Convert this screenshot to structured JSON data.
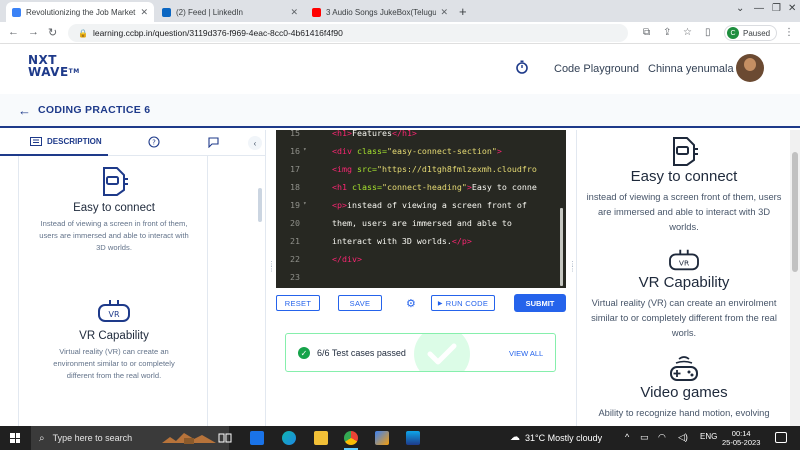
{
  "browser": {
    "tabs": [
      {
        "title": "Revolutionizing the Job Market |",
        "favicon_color": "#3b82f6",
        "active": true
      },
      {
        "title": "(2) Feed | LinkedIn",
        "favicon_color": "#0a66c2",
        "active": false
      },
      {
        "title": "3 Audio Songs JukeBox(Telugu) |",
        "favicon_color": "#ff0000",
        "active": false
      }
    ],
    "url": "learning.ccbp.in/question/3119d376-f969-4eac-8cc0-4b61416f4f90",
    "profile_initial": "C",
    "profile_status": "Paused"
  },
  "site": {
    "logo_line1": "NXT",
    "logo_line2": "WAVE",
    "logo_sub": "TM",
    "nav_playground": "Code Playground",
    "user_name": "Chinna yenumala",
    "brand_color": "#1e3a8a"
  },
  "practice": {
    "title": "CODING PRACTICE 6"
  },
  "left_panel": {
    "tab_description": "DESCRIPTION",
    "features": [
      {
        "icon": "vr-headset-icon",
        "heading": "Easy to connect",
        "text": "Instead of viewing a screen in front of them, users are immersed and able to interact with 3D worlds."
      },
      {
        "icon": "vr-goggles-icon",
        "heading": "VR Capability",
        "text": "Virtual reality (VR) can create an environment similar to or completely different from the real world."
      }
    ]
  },
  "editor": {
    "lines": [
      {
        "num": "15",
        "fold": false,
        "parts": [
          {
            "t": "tag",
            "v": "<h1>"
          },
          {
            "t": "txt",
            "v": "Features"
          },
          {
            "t": "tag",
            "v": "</h1>"
          }
        ]
      },
      {
        "num": "16",
        "fold": true,
        "parts": [
          {
            "t": "tag",
            "v": "<div "
          },
          {
            "t": "attr",
            "v": "class="
          },
          {
            "t": "str",
            "v": "\"easy-connect-section\""
          },
          {
            "t": "tag",
            "v": ">"
          }
        ]
      },
      {
        "num": "17",
        "fold": false,
        "parts": [
          {
            "t": "tag",
            "v": "<img "
          },
          {
            "t": "attr",
            "v": "src="
          },
          {
            "t": "str",
            "v": "\"https://d1tgh8fmlzexmh.cloudfro"
          }
        ]
      },
      {
        "num": "18",
        "fold": false,
        "parts": [
          {
            "t": "tag",
            "v": "<h1 "
          },
          {
            "t": "attr",
            "v": "class="
          },
          {
            "t": "str",
            "v": "\"connect-heading\""
          },
          {
            "t": "tag",
            "v": ">"
          },
          {
            "t": "txt",
            "v": "Easy to conne"
          }
        ]
      },
      {
        "num": "19",
        "fold": true,
        "parts": [
          {
            "t": "tag",
            "v": "<p>"
          },
          {
            "t": "txt",
            "v": "instead of viewing a screen front of"
          }
        ]
      },
      {
        "num": "20",
        "fold": false,
        "parts": [
          {
            "t": "txt",
            "v": "them, users are immersed and able to"
          }
        ]
      },
      {
        "num": "21",
        "fold": false,
        "parts": [
          {
            "t": "txt",
            "v": "interact with 3D worlds."
          },
          {
            "t": "tag",
            "v": "</p>"
          }
        ]
      },
      {
        "num": "22",
        "fold": false,
        "parts": [
          {
            "t": "tag",
            "v": "</div>"
          }
        ]
      },
      {
        "num": "23",
        "fold": false,
        "parts": []
      }
    ]
  },
  "actions": {
    "reset": "RESET",
    "save": "SAVE",
    "run": "RUN CODE",
    "submit": "SUBMIT"
  },
  "result": {
    "text": "6/6 Test cases passed",
    "view_all": "VIEW ALL"
  },
  "preview": {
    "features": [
      {
        "icon": "vr-headset-icon",
        "heading": "Easy to connect",
        "text": "instead of viewing a screen front of them, users are immersed and able to interact with 3D worlds."
      },
      {
        "icon": "vr-goggles-icon",
        "heading": "VR Capability",
        "text": "Virtual reality (VR) can create an envirolment similar to or completely different from the real worls."
      },
      {
        "icon": "gamepad-icon",
        "heading": "Video games",
        "text": "Ability to recognize hand motion, evolving"
      }
    ]
  },
  "taskbar": {
    "search_placeholder": "Type here to search",
    "weather": "31°C  Mostly cloudy",
    "lang": "ENG",
    "time": "00:14",
    "date": "25-05-2023"
  }
}
